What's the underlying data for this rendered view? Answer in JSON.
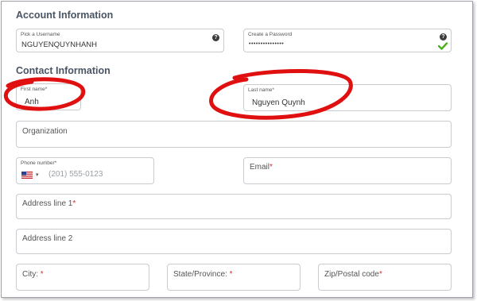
{
  "account": {
    "heading": "Account Information",
    "username": {
      "label": "Pick a Username",
      "value": "NGUYENQUYNHANH",
      "help_icon": "?"
    },
    "password": {
      "label": "Create a Password",
      "value": "•••••••••••••••",
      "help_icon": "?"
    }
  },
  "contact": {
    "heading": "Contact Information",
    "first_name": {
      "label": "First name*",
      "value": "Anh"
    },
    "last_name": {
      "label": "Last name*",
      "value": "Nguyen Quynh"
    },
    "organization": {
      "label": "Organization"
    },
    "phone": {
      "label": "Phone number*",
      "country_arrow": "▾",
      "placeholder": "(201) 555-0123"
    },
    "email": {
      "label": "Email",
      "required": "*"
    },
    "address1": {
      "label": "Address line 1",
      "required": "*"
    },
    "address2": {
      "label": "Address line 2"
    },
    "city": {
      "label": "City: ",
      "required": "*"
    },
    "state": {
      "label": "State/Province: ",
      "required": "*"
    },
    "zip": {
      "label": "Zip/Postal code",
      "required": "*"
    }
  },
  "colors": {
    "annotation_red": "#e01010",
    "check_green": "#4caf1e",
    "required_red": "#d0312d"
  },
  "icons": [
    "help-icon",
    "check-icon",
    "us-flag-icon",
    "chevron-down-icon"
  ]
}
